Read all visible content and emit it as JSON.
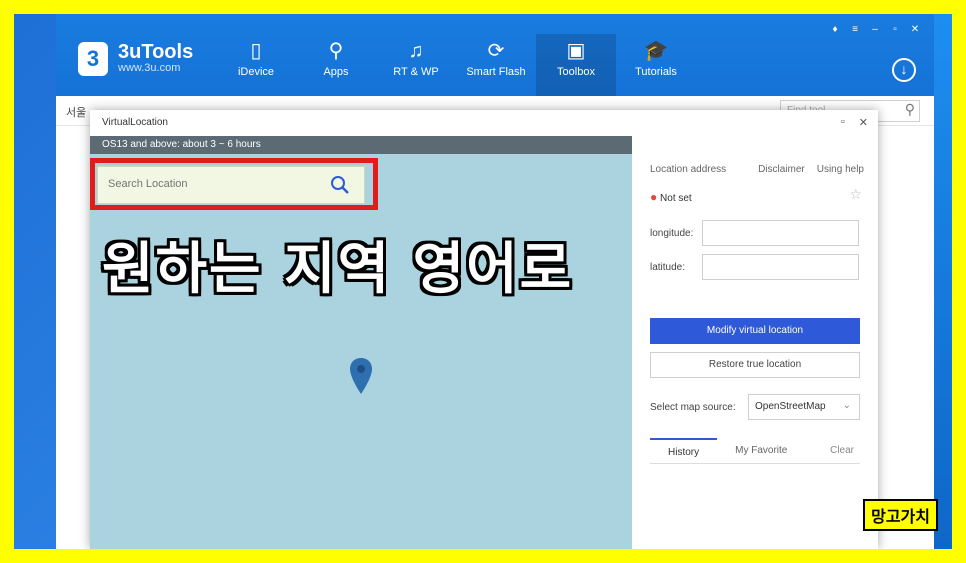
{
  "app": {
    "brand_name": "3uTools",
    "brand_url": "www.3u.com",
    "logo_glyph": "3",
    "nav": [
      {
        "label": "iDevice",
        "icon": "phone-icon",
        "glyph": "▯"
      },
      {
        "label": "Apps",
        "icon": "apps-icon",
        "glyph": "⚲"
      },
      {
        "label": "RT & WP",
        "icon": "music-icon",
        "glyph": "♫"
      },
      {
        "label": "Smart Flash",
        "icon": "flash-icon",
        "glyph": "⟳"
      },
      {
        "label": "Toolbox",
        "icon": "toolbox-icon",
        "glyph": "▣"
      },
      {
        "label": "Tutorials",
        "icon": "graduation-icon",
        "glyph": "🎓"
      }
    ],
    "active_nav": "Toolbox",
    "subbar_left": "서울",
    "find_tool_placeholder": "Find tool"
  },
  "dialog": {
    "title": "VirtualLocation",
    "notice": "OS13 and above: about 3 ~ 6 hours",
    "search_placeholder": "Search Location"
  },
  "panel": {
    "location_address": "Location address",
    "disclaimer": "Disclaimer",
    "using_help": "Using help",
    "not_set": "Not set",
    "longitude_label": "longitude:",
    "latitude_label": "latitude:",
    "modify_button": "Modify virtual location",
    "restore_button": "Restore true location",
    "map_source_label": "Select map source:",
    "map_source_value": "OpenStreetMap",
    "tab_history": "History",
    "tab_favorite": "My Favorite",
    "clear": "Clear"
  },
  "overlay": {
    "caption": "원하는 지역 영어로",
    "stamp": "망고가치"
  },
  "colors": {
    "frame": "#ffff00",
    "topbar": "#1572d6",
    "map_water": "#aad3df",
    "primary_button": "#2e59d9",
    "highlight": "#e21b1b"
  }
}
